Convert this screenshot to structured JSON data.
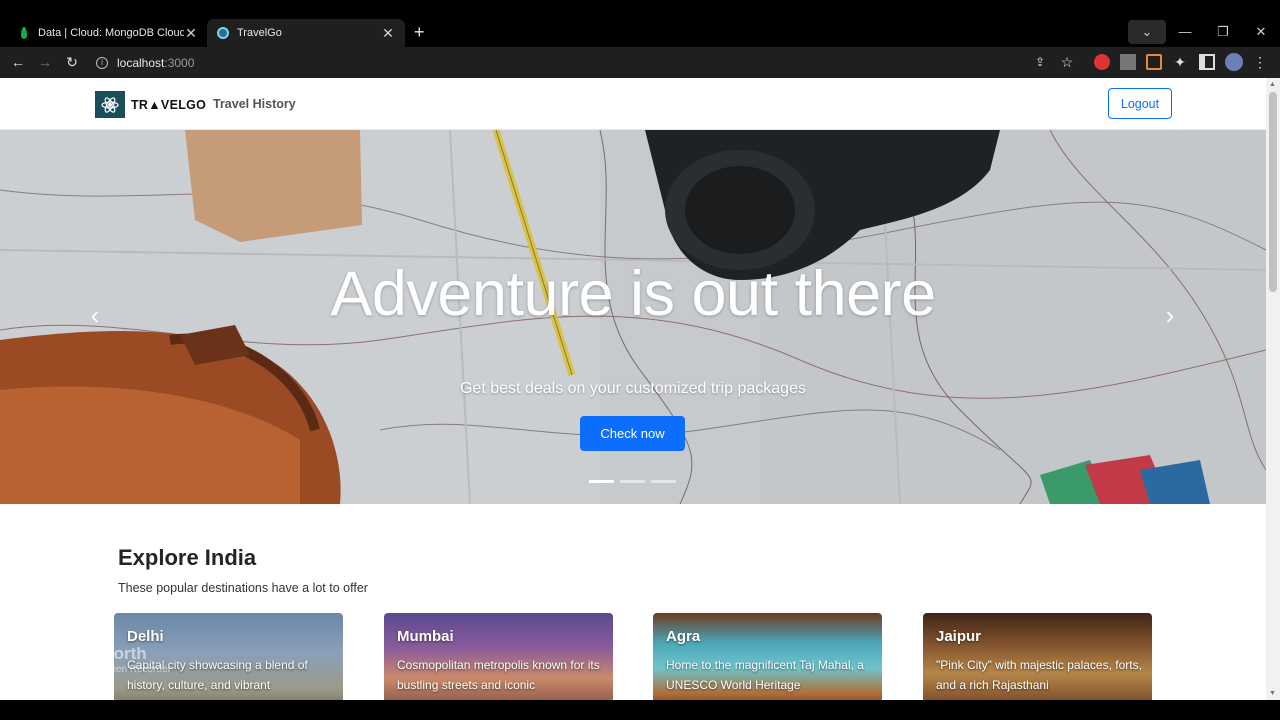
{
  "browser": {
    "tabs": [
      {
        "title": "Data | Cloud: MongoDB Cloud",
        "active": false
      },
      {
        "title": "TravelGo",
        "active": true
      }
    ],
    "url_host": "localhost",
    "url_port": ":3000"
  },
  "navbar": {
    "brand": "TR▲VELGO",
    "link": "Travel History",
    "logout": "Logout"
  },
  "hero": {
    "title": "Adventure is out there",
    "subtitle": "Get best deals on your customized trip packages",
    "button": "Check now",
    "slide_count": 3,
    "active_slide": 1
  },
  "explore": {
    "title": "Explore India",
    "subtitle": "These popular destinations have a lot to offer",
    "cards": [
      {
        "name": "Delhi",
        "desc": "Capital city showcasing a blend of history, culture, and vibrant"
      },
      {
        "name": "Mumbai",
        "desc": "Cosmopolitan metropolis known for its bustling streets and iconic"
      },
      {
        "name": "Agra",
        "desc": "Home to the magnificent Taj Mahal, a UNESCO World Heritage"
      },
      {
        "name": "Jaipur",
        "desc": "\"Pink City\" with majestic palaces, forts, and a rich Rajasthani"
      }
    ]
  },
  "watermark": {
    "name": "RecForth",
    "tagline": "Free Screen Recorder"
  }
}
